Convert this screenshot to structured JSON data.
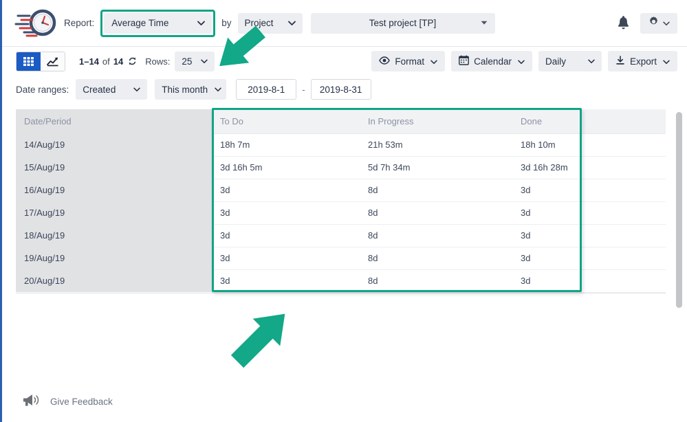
{
  "header": {
    "logo_icon": "speeding-clock-logo",
    "report_label": "Report:",
    "report_value": "Average Time",
    "by_label": "by",
    "group_by_value": "Project",
    "project_value": "Test project [TP]",
    "bell_icon": "notification-bell-icon",
    "gear_icon": "gear-icon",
    "chevron_icon": "chevron-down-icon"
  },
  "toolbar": {
    "grid_view_icon": "grid-view-icon",
    "chart_view_icon": "chart-view-icon",
    "range_text": "1–14",
    "of_text": "of",
    "total_text": "14",
    "refresh_icon": "refresh-icon",
    "rows_label": "Rows:",
    "rows_value": "25",
    "format_label": "Format",
    "format_icon": "eye-icon",
    "calendar_label": "Calendar",
    "calendar_icon": "calendar-icon",
    "period_value": "Daily",
    "export_label": "Export",
    "export_icon": "download-icon"
  },
  "date_ranges": {
    "label": "Date ranges:",
    "field_value": "Created",
    "period_value": "This month",
    "start_date": "2019-8-1",
    "separator": "-",
    "end_date": "2019-8-31"
  },
  "table": {
    "columns": [
      "Date/Period",
      "To Do",
      "In Progress",
      "Done",
      ""
    ],
    "rows": [
      {
        "date": "14/Aug/19",
        "todo": "18h 7m",
        "in_progress": "21h 53m",
        "done": "18h 10m",
        "extra": ""
      },
      {
        "date": "15/Aug/19",
        "todo": "3d 16h 5m",
        "in_progress": "5d 7h 34m",
        "done": "3d 16h 28m",
        "extra": ""
      },
      {
        "date": "16/Aug/19",
        "todo": "3d",
        "in_progress": "8d",
        "done": "3d",
        "extra": ""
      },
      {
        "date": "17/Aug/19",
        "todo": "3d",
        "in_progress": "8d",
        "done": "3d",
        "extra": ""
      },
      {
        "date": "18/Aug/19",
        "todo": "3d",
        "in_progress": "8d",
        "done": "3d",
        "extra": ""
      },
      {
        "date": "19/Aug/19",
        "todo": "3d",
        "in_progress": "8d",
        "done": "3d",
        "extra": ""
      },
      {
        "date": "20/Aug/19",
        "todo": "3d",
        "in_progress": "8d",
        "done": "3d",
        "extra": ""
      }
    ]
  },
  "annotations": {
    "highlight_color": "#0fa487",
    "arrow_color": "#12a888",
    "report_highlight": "average-time-dropdown-highlight",
    "table_highlight": "status-columns-highlight",
    "arrow_top": "arrow-pointing-to-report-dropdown",
    "arrow_bottom": "arrow-pointing-to-table-columns"
  },
  "footer": {
    "feedback_icon": "megaphone-icon",
    "feedback_label": "Give Feedback"
  },
  "colors": {
    "accent_blue": "#1a5bc4",
    "teal_highlight": "#0fa487",
    "text_dark": "#263045",
    "header_gray": "#f1f2f4",
    "date_col_gray": "#e1e2e4"
  }
}
